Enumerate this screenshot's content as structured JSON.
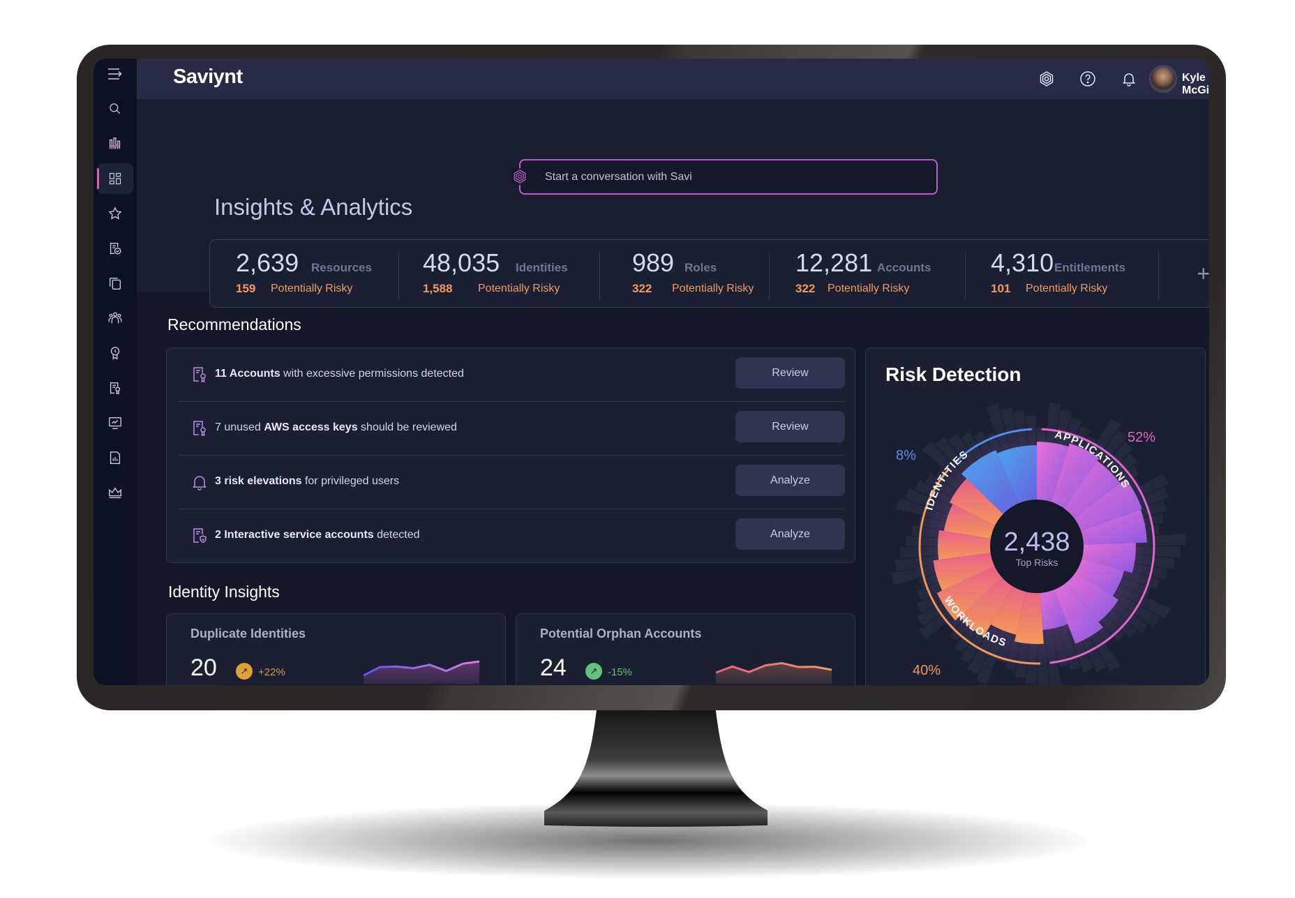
{
  "app": {
    "brand": "Saviynt",
    "user_name": "Kyle McGill"
  },
  "sidebar": {
    "items": [
      {
        "icon": "menu-expand-icon",
        "label": "Menu"
      },
      {
        "icon": "search-icon",
        "label": "Search"
      },
      {
        "icon": "analytics-icon",
        "label": "Analytics"
      },
      {
        "icon": "dashboard-icon",
        "label": "Dashboard",
        "active": true
      },
      {
        "icon": "star-icon",
        "label": "Favorites"
      },
      {
        "icon": "certification-icon",
        "label": "Certifications"
      },
      {
        "icon": "copy-icon",
        "label": "Requests"
      },
      {
        "icon": "users-icon",
        "label": "Identities"
      },
      {
        "icon": "award-icon",
        "label": "Roles"
      },
      {
        "icon": "document-award-icon",
        "label": "Policies"
      },
      {
        "icon": "monitor-chart-icon",
        "label": "Monitoring"
      },
      {
        "icon": "report-icon",
        "label": "Reports"
      },
      {
        "icon": "crown-icon",
        "label": "Admin"
      }
    ]
  },
  "header": {
    "icons": [
      "savi-icon",
      "help-icon",
      "notifications-icon"
    ]
  },
  "savi": {
    "placeholder": "Start a conversation with Savi"
  },
  "page": {
    "title": "Insights & Analytics"
  },
  "stats": [
    {
      "value": "2,639",
      "label": "Resources",
      "risky_count": "159",
      "risky_label": "Potentially Risky"
    },
    {
      "value": "48,035",
      "label": "Identities",
      "risky_count": "1,588",
      "risky_label": "Potentially Risky"
    },
    {
      "value": "989",
      "label": "Roles",
      "risky_count": "322",
      "risky_label": "Potentially Risky"
    },
    {
      "value": "12,281",
      "label": "Accounts",
      "risky_count": "322",
      "risky_label": "Potentially Risky"
    },
    {
      "value": "4,310",
      "label": "Entitlements",
      "risky_count": "101",
      "risky_label": "Potentially Risky"
    }
  ],
  "stats_add_label": "+",
  "recommendations": {
    "title": "Recommendations",
    "items": [
      {
        "icon": "document-award-icon",
        "pre": "",
        "bold": "11 Accounts",
        "post": " with excessive permissions detected",
        "action": "Review"
      },
      {
        "icon": "document-award-icon",
        "pre": "7 unused ",
        "bold": "AWS access keys",
        "post": " should be reviewed",
        "action": "Review"
      },
      {
        "icon": "bell-icon",
        "pre": "",
        "bold": "3 risk elevations",
        "post": " for privileged users",
        "action": "Analyze"
      },
      {
        "icon": "document-shield-icon",
        "pre": "",
        "bold": "2 Interactive service accounts",
        "post": " detected",
        "action": "Analyze"
      }
    ]
  },
  "risk_detection": {
    "title": "Risk Detection",
    "center_value": "2,438",
    "center_label": "Top Risks",
    "segments": [
      {
        "name": "IDENTITIES",
        "percent": "8%",
        "color": "#4f8fe8"
      },
      {
        "name": "APPLICATIONS",
        "percent": "52%",
        "color": "#e066cf"
      },
      {
        "name": "WORKLOADS",
        "percent": "40%",
        "color": "#f0975a"
      }
    ]
  },
  "identity_insights": {
    "title": "Identity Insights",
    "cards": [
      {
        "title": "Duplicate Identities",
        "value": "20",
        "delta": "+22%",
        "badge_color": "#e0a03c",
        "delta_color": "#d99a42",
        "trend_icon": "arrow-up-right-icon",
        "sparkline": [
          2,
          5,
          5.2,
          4.6,
          5.8,
          3.6,
          6.2,
          7
        ]
      },
      {
        "title": "Potential Orphan Accounts",
        "value": "24",
        "delta": "-15%",
        "badge_color": "#62c27a",
        "delta_color": "#5fbf76",
        "trend_icon": "arrow-up-right-icon",
        "sparkline": [
          3,
          5.2,
          3.2,
          5.6,
          6.4,
          5,
          5.1,
          4
        ]
      }
    ]
  }
}
